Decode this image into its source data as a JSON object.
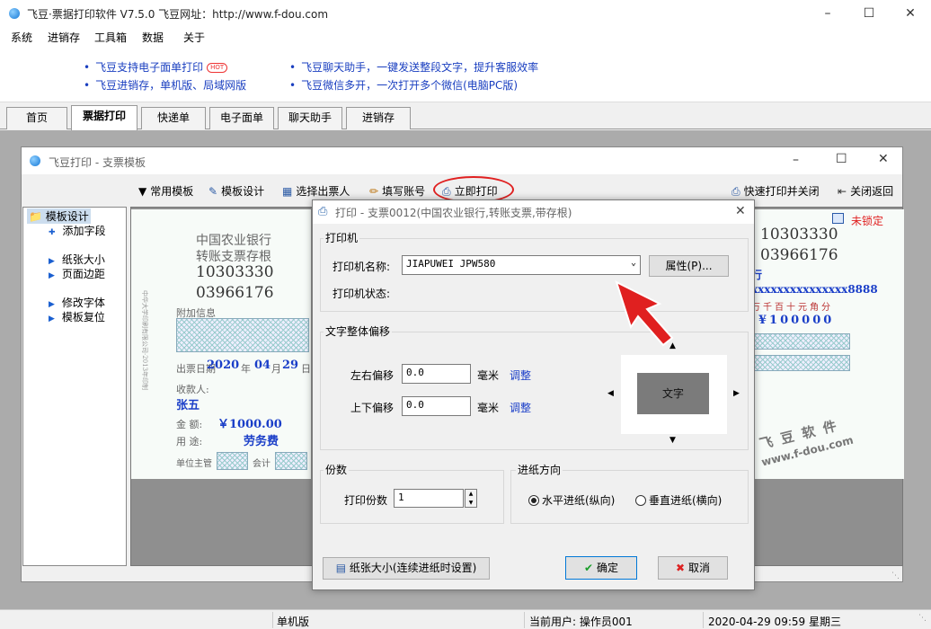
{
  "app": {
    "title": "飞豆·票据打印软件 V7.5.0   飞豆网址：http://www.f-dou.com"
  },
  "menu": [
    "系统",
    "进销存",
    "工具箱",
    "数据",
    "关于"
  ],
  "ads": {
    "left": [
      "飞豆支持电子面单打印",
      "飞豆进销存，单机版、局域网版"
    ],
    "right": [
      "飞豆聊天助手，一键发送整段文字，提升客服效率",
      "飞豆微信多开，一次打开多个微信(电脑PC版)"
    ],
    "hot": "HOT"
  },
  "tabs": [
    "首页",
    "票据打印",
    "快递单",
    "电子面单",
    "聊天助手",
    "进销存"
  ],
  "inner": {
    "title": "飞豆打印 - 支票模板",
    "toolbar": {
      "common_templates": "常用模板",
      "template_design": "模板设计",
      "select_drawer": "选择出票人",
      "fill_account": "填写账号",
      "print_now": "立即打印",
      "quick_print_close": "快速打印并关闭",
      "close_back": "关闭返回"
    },
    "tree": {
      "root": "模板设计",
      "items": [
        "添加字段",
        "纸张大小",
        "页面边距",
        "修改字体",
        "模板复位"
      ]
    }
  },
  "cheque": {
    "bank": "中国农业银行",
    "type": "转账支票存根",
    "no1": "10303330",
    "no2": "03966176",
    "attach": "附加信息",
    "date_label": "出票日期",
    "year": "2020",
    "year_label": "年",
    "month": "04",
    "month_label": "月",
    "day": "29",
    "day_label": "日",
    "payee_label": "收款人:",
    "payee": "张五",
    "amount_label": "金  额:",
    "amount": "￥1000.00",
    "use_label": "用  途:",
    "use": "劳务费",
    "unit_label": "单位主管",
    "accountant": "会计",
    "side_text": "中华大学印刷有限公司·2013年印制",
    "right_no1": "10303330",
    "right_no2": "03966176",
    "unlocked": "未锁定",
    "row": "行",
    "acct": "xxxxxxxxxxxxxxx8888",
    "units": [
      "万",
      "千",
      "百",
      "十",
      "元",
      "角",
      "分"
    ],
    "digits": "¥100000"
  },
  "watermark": {
    "line1": "飞 豆 软 件",
    "line2": "www.f-dou.com"
  },
  "dialog": {
    "title": "打印 - 支票0012(中国农业银行,转账支票,带存根)",
    "printer_group": "打印机",
    "printer_name_label": "打印机名称:",
    "printer_name": "JIAPUWEI JPW580",
    "properties": "属性(P)...",
    "printer_status_label": "打印机状态:",
    "printer_status": "",
    "offset_group": "文字整体偏移",
    "lr_label": "左右偏移",
    "lr_value": "0.0",
    "ud_label": "上下偏移",
    "ud_value": "0.0",
    "unit": "毫米",
    "adjust": "调整",
    "preview_text": "文字",
    "copies_group": "份数",
    "copies_label": "打印份数",
    "copies_value": "1",
    "feed_group": "进纸方向",
    "feed_h": "水平进纸(纵向)",
    "feed_v": "垂直进纸(横向)",
    "paper_size_btn": "纸张大小(连续进纸时设置)",
    "ok": "确定",
    "cancel": "取消"
  },
  "status": {
    "mode": "单机版",
    "user": "当前用户: 操作员001",
    "datetime": "2020-04-29 09:59 星期三"
  },
  "colors": {
    "accent_red": "#e02020",
    "link_blue": "#1a3ec8",
    "field_blue": "#1a3ec8"
  }
}
